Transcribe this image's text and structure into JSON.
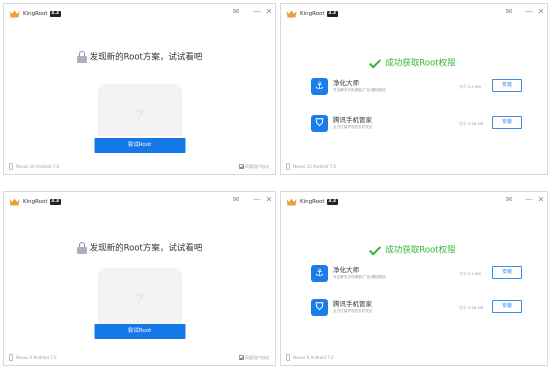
{
  "brand": {
    "name": "KingRoot",
    "version": "3.3"
  },
  "titlebar_controls": {
    "mail": "✉",
    "minimize": "—",
    "close": "✕"
  },
  "root_panel": {
    "headline": "发现新的Root方案，试试看吧",
    "phone_placeholder": "?",
    "try_button": "尝试Root",
    "agreement": "同意用户协议"
  },
  "success_panel": {
    "headline": "成功获取Root权限",
    "apps": [
      {
        "name": "净化大师",
        "desc": "专注解决手机弹窗/广告/通知烦扰",
        "size": "大小 5.4 MB",
        "install": "安装",
        "icon_color": "#1a7de8",
        "icon": "broom-icon",
        "glyph": "⚓"
      },
      {
        "name": "腾讯手机管家",
        "desc": "全方位保护您的手机安全",
        "size": "大小 3.98 MB",
        "install": "安装",
        "icon_color": "#1a7de8",
        "icon": "shield-icon",
        "glyph": "⛉"
      }
    ]
  },
  "top_row": {
    "device": "Nexus 10 Android 7.0"
  },
  "bottom_row": {
    "device": "Nexus 6 Android 7.0"
  },
  "colors": {
    "accent_blue": "#1478e8",
    "success_green": "#35b532"
  }
}
